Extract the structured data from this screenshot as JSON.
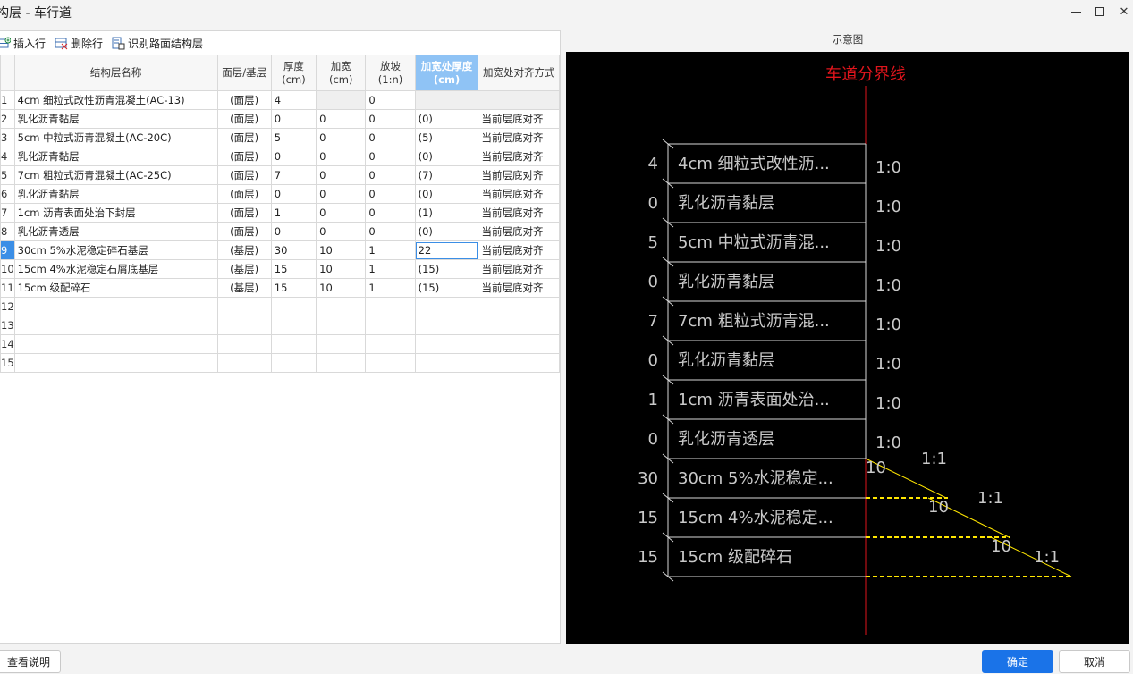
{
  "window": {
    "title": "构层 - 车行道",
    "min_glyph": "—",
    "close_glyph": "✕"
  },
  "toolbar": {
    "insert_row": "插入行",
    "delete_row": "删除行",
    "identify": "识别路面结构层"
  },
  "table": {
    "headers": {
      "name": "结构层名称",
      "type": "面层/基层",
      "thickness": "厚度\n(cm)",
      "widen": "加宽\n(cm)",
      "slope": "放坡\n(1:n)",
      "widen_thickness": "加宽处厚度\n(cm)",
      "align": "加宽处对齐方式"
    },
    "rows": [
      {
        "idx": "1",
        "name": "4cm 细粒式改性沥青混凝土(AC-13)",
        "type": "(面层)",
        "thickness": "4",
        "widen": "",
        "slope": "0",
        "widen_thickness": "",
        "align": ""
      },
      {
        "idx": "2",
        "name": "乳化沥青黏层",
        "type": "(面层)",
        "thickness": "0",
        "widen": "0",
        "slope": "0",
        "widen_thickness": "(0)",
        "align": "当前层底对齐"
      },
      {
        "idx": "3",
        "name": "5cm 中粒式沥青混凝土(AC-20C)",
        "type": "(面层)",
        "thickness": "5",
        "widen": "0",
        "slope": "0",
        "widen_thickness": "(5)",
        "align": "当前层底对齐"
      },
      {
        "idx": "4",
        "name": "乳化沥青黏层",
        "type": "(面层)",
        "thickness": "0",
        "widen": "0",
        "slope": "0",
        "widen_thickness": "(0)",
        "align": "当前层底对齐"
      },
      {
        "idx": "5",
        "name": "7cm 粗粒式沥青混凝土(AC-25C)",
        "type": "(面层)",
        "thickness": "7",
        "widen": "0",
        "slope": "0",
        "widen_thickness": "(7)",
        "align": "当前层底对齐"
      },
      {
        "idx": "6",
        "name": "乳化沥青黏层",
        "type": "(面层)",
        "thickness": "0",
        "widen": "0",
        "slope": "0",
        "widen_thickness": "(0)",
        "align": "当前层底对齐"
      },
      {
        "idx": "7",
        "name": "1cm 沥青表面处治下封层",
        "type": "(面层)",
        "thickness": "1",
        "widen": "0",
        "slope": "0",
        "widen_thickness": "(1)",
        "align": "当前层底对齐"
      },
      {
        "idx": "8",
        "name": "乳化沥青透层",
        "type": "(面层)",
        "thickness": "0",
        "widen": "0",
        "slope": "0",
        "widen_thickness": "(0)",
        "align": "当前层底对齐"
      },
      {
        "idx": "9",
        "name": "30cm 5%水泥稳定碎石基层",
        "type": "(基层)",
        "thickness": "30",
        "widen": "10",
        "slope": "1",
        "widen_thickness": "22",
        "align": "当前层底对齐"
      },
      {
        "idx": "10",
        "name": "15cm 4%水泥稳定石屑底基层",
        "type": "(基层)",
        "thickness": "15",
        "widen": "10",
        "slope": "1",
        "widen_thickness": "(15)",
        "align": "当前层底对齐"
      },
      {
        "idx": "11",
        "name": "15cm 级配碎石",
        "type": "(基层)",
        "thickness": "15",
        "widen": "10",
        "slope": "1",
        "widen_thickness": "(15)",
        "align": "当前层底对齐"
      },
      {
        "idx": "12",
        "name": "",
        "type": "",
        "thickness": "",
        "widen": "",
        "slope": "",
        "widen_thickness": "",
        "align": ""
      },
      {
        "idx": "13",
        "name": "",
        "type": "",
        "thickness": "",
        "widen": "",
        "slope": "",
        "widen_thickness": "",
        "align": ""
      },
      {
        "idx": "14",
        "name": "",
        "type": "",
        "thickness": "",
        "widen": "",
        "slope": "",
        "widen_thickness": "",
        "align": ""
      },
      {
        "idx": "15",
        "name": "",
        "type": "",
        "thickness": "",
        "widen": "",
        "slope": "",
        "widen_thickness": "",
        "align": ""
      }
    ]
  },
  "preview": {
    "panel_title": "示意图",
    "boundary_label": "车道分界线",
    "layers": [
      {
        "thickness": "4",
        "label": "4cm 细粒式改性沥...",
        "slope": "1:0"
      },
      {
        "thickness": "0",
        "label": "乳化沥青黏层",
        "slope": "1:0"
      },
      {
        "thickness": "5",
        "label": "5cm 中粒式沥青混...",
        "slope": "1:0"
      },
      {
        "thickness": "0",
        "label": "乳化沥青黏层",
        "slope": "1:0"
      },
      {
        "thickness": "7",
        "label": "7cm 粗粒式沥青混...",
        "slope": "1:0"
      },
      {
        "thickness": "0",
        "label": "乳化沥青黏层",
        "slope": "1:0"
      },
      {
        "thickness": "1",
        "label": "1cm 沥青表面处治...",
        "slope": "1:0"
      },
      {
        "thickness": "0",
        "label": "乳化沥青透层",
        "slope": "1:0"
      },
      {
        "thickness": "30",
        "label": "30cm 5%水泥稳定...",
        "slope": "1:1",
        "widen": "10"
      },
      {
        "thickness": "15",
        "label": "15cm 4%水泥稳定...",
        "slope": "1:1",
        "widen": "10"
      },
      {
        "thickness": "15",
        "label": "15cm 级配碎石",
        "slope": "1:1",
        "widen": "10"
      }
    ],
    "colors": {
      "boundary": "#e0151c",
      "lines": "#d8d8d8",
      "dash": "#ffe600",
      "background": "#000000"
    }
  },
  "footer": {
    "help": "查看说明",
    "ok": "确定",
    "cancel": "取消"
  }
}
